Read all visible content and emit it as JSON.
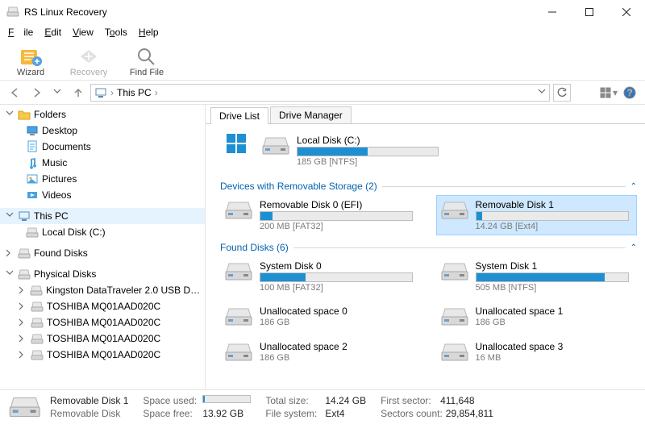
{
  "window": {
    "title": "RS Linux Recovery"
  },
  "menu": {
    "file": "File",
    "edit": "Edit",
    "view": "View",
    "tools": "Tools",
    "help": "Help"
  },
  "toolbar": {
    "wizard": "Wizard",
    "recovery": "Recovery",
    "findfile": "Find File"
  },
  "address": {
    "root": "This PC"
  },
  "sidebar": {
    "folders": {
      "label": "Folders",
      "items": [
        {
          "label": "Desktop",
          "icon": "desktop"
        },
        {
          "label": "Documents",
          "icon": "doc"
        },
        {
          "label": "Music",
          "icon": "music"
        },
        {
          "label": "Pictures",
          "icon": "pic"
        },
        {
          "label": "Videos",
          "icon": "video"
        }
      ]
    },
    "thispc": {
      "label": "This PC",
      "items": [
        {
          "label": "Local Disk (C:)"
        }
      ]
    },
    "found": {
      "label": "Found Disks"
    },
    "physical": {
      "label": "Physical Disks",
      "items": [
        {
          "label": "Kingston DataTraveler 2.0 USB Device"
        },
        {
          "label": "TOSHIBA MQ01AAD020C"
        },
        {
          "label": "TOSHIBA MQ01AAD020C"
        },
        {
          "label": "TOSHIBA MQ01AAD020C"
        },
        {
          "label": "TOSHIBA MQ01AAD020C"
        }
      ]
    }
  },
  "tabs": {
    "list": "Drive List",
    "manager": "Drive Manager"
  },
  "sections": {
    "local": {
      "name": "Local Disk (C:)",
      "sub": "185 GB [NTFS]",
      "fill": 50
    },
    "removable_hdr": "Devices with Removable Storage (2)",
    "removable": [
      {
        "name": "Removable Disk 0 (EFI)",
        "sub": "200 MB [FAT32]",
        "fill": 8,
        "selected": false
      },
      {
        "name": "Removable Disk 1",
        "sub": "14.24 GB [Ext4]",
        "fill": 4,
        "selected": true
      }
    ],
    "found_hdr": "Found Disks (6)",
    "found": [
      {
        "name": "System Disk 0",
        "sub": "100 MB [FAT32]",
        "fill": 30
      },
      {
        "name": "System Disk 1",
        "sub": "505 MB [NTFS]",
        "fill": 85
      },
      {
        "name": "Unallocated space 0",
        "sub": "186 GB",
        "fill": 0
      },
      {
        "name": "Unallocated space 1",
        "sub": "186 GB",
        "fill": 0
      },
      {
        "name": "Unallocated space 2",
        "sub": "186 GB",
        "fill": 0
      },
      {
        "name": "Unallocated space 3",
        "sub": "16 MB",
        "fill": 0
      }
    ]
  },
  "status": {
    "name": "Removable Disk 1",
    "type": "Removable Disk",
    "used_label": "Space used:",
    "used_pct": 3,
    "free_label": "Space free:",
    "free_val": "13.92 GB",
    "total_label": "Total size:",
    "total_val": "14.24 GB",
    "fs_label": "File system:",
    "fs_val": "Ext4",
    "first_label": "First sector:",
    "first_val": "411,648",
    "count_label": "Sectors count:",
    "count_val": "29,854,811"
  }
}
